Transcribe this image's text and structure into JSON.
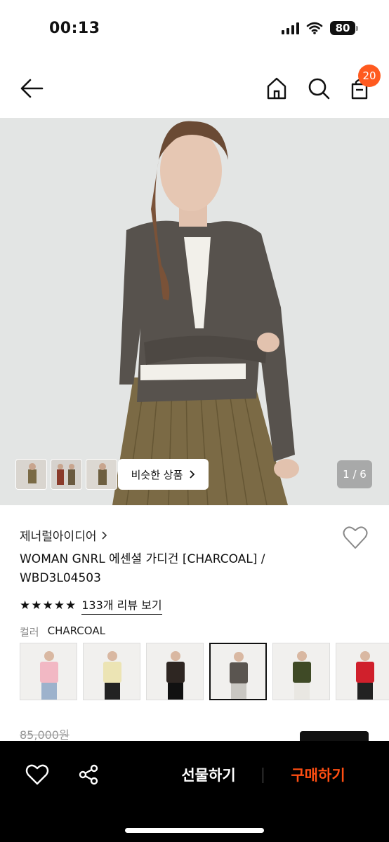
{
  "status_bar": {
    "time": "00:13",
    "battery": "80",
    "icons": [
      "signal-icon",
      "wifi-icon",
      "battery-icon"
    ]
  },
  "nav": {
    "icons": [
      "back-arrow-icon",
      "home-icon",
      "search-icon",
      "shopping-bag-icon"
    ],
    "cart_count": "20"
  },
  "hero": {
    "similar_products_label": "비슷한 상품",
    "page_indicator": "1 / 6",
    "thumbnail_count": 3
  },
  "product": {
    "brand": "제너럴아이디어",
    "name": "WOMAN GNRL 에센셜 가디건 [CHARCOAL] / WBD3L04503",
    "rating": 5,
    "review_link": "133개 리뷰 보기",
    "color_label": "컬러",
    "color_value": "CHARCOAL",
    "original_price": "85,000원"
  },
  "color_options": [
    {
      "color": "#f2b8c4",
      "selected": false
    },
    {
      "color": "#ece4b4",
      "selected": false
    },
    {
      "color": "#2e2622",
      "selected": false
    },
    {
      "color": "#5a5550",
      "selected": true
    },
    {
      "color": "#3f4a26",
      "selected": false
    },
    {
      "color": "#d0202c",
      "selected": false
    }
  ],
  "bottom_bar": {
    "gift_label": "선물하기",
    "buy_label": "구매하기",
    "icons": [
      "heart-icon",
      "share-icon"
    ]
  },
  "colors": {
    "accent": "#ff4e12",
    "badge": "#ff5a1f"
  }
}
